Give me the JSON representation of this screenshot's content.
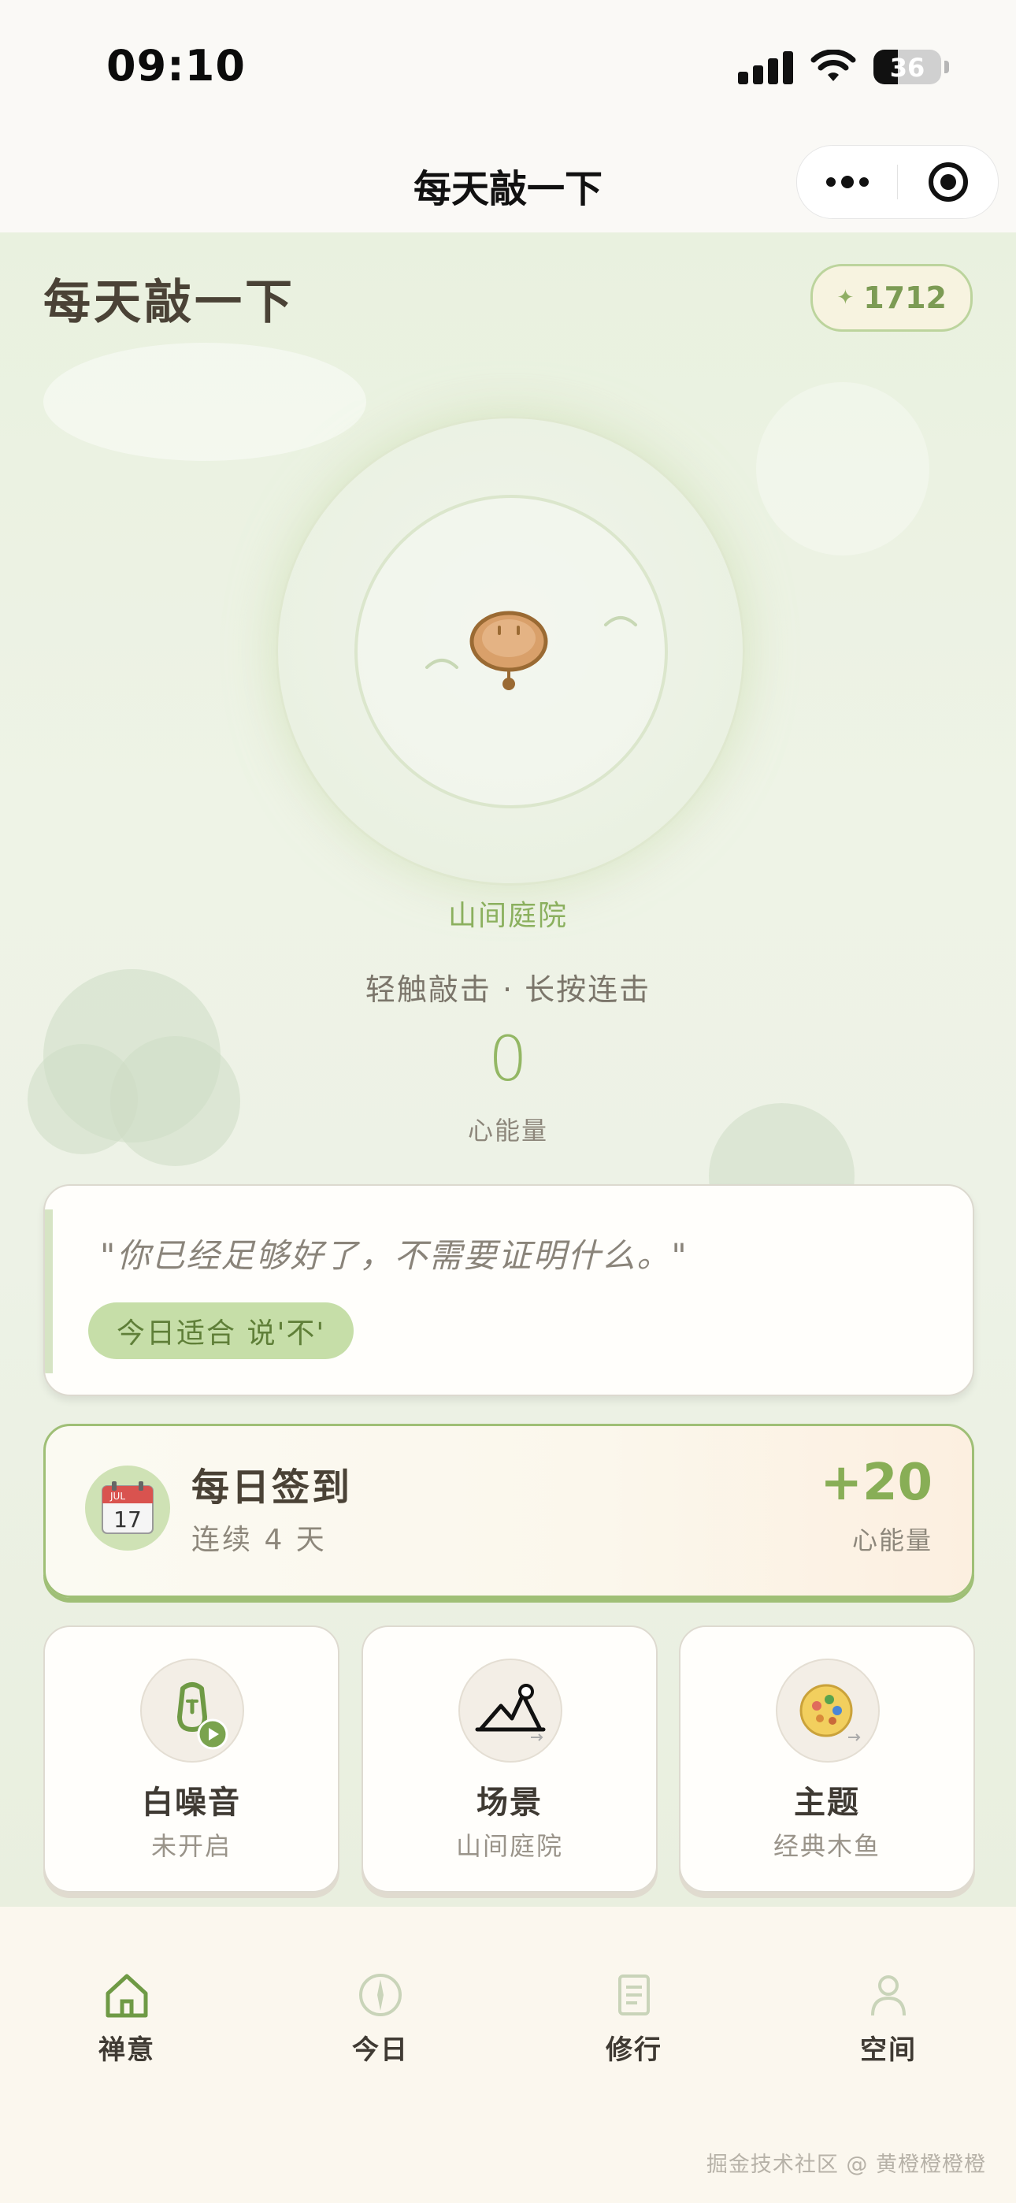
{
  "status_bar": {
    "time": "09:10",
    "battery": "36",
    "battery_percent": 36
  },
  "nav": {
    "title": "每天敲一下",
    "more_icon": "more-dots-icon",
    "close_icon": "target-circle-icon"
  },
  "header": {
    "app_title": "每天敲一下",
    "energy_total": "1712",
    "energy_icon": "sparkle-icon"
  },
  "tap_area": {
    "scene_name": "山间庭院",
    "hint": "轻触敲击 · 长按连击",
    "count": "0",
    "count_label": "心能量",
    "object_icon": "wooden-fish-icon"
  },
  "quote_card": {
    "quote": "\"你已经足够好了，不需要证明什么。\"",
    "tag": "今日适合 说'不'"
  },
  "checkin": {
    "title": "每日签到",
    "streak": "连续 4 天",
    "reward": "+20",
    "reward_unit": "心能量",
    "calendar_month": "JUL",
    "calendar_day": "17"
  },
  "tiles": [
    {
      "title": "白噪音",
      "subtitle": "未开启",
      "icon": "white-noise-icon"
    },
    {
      "title": "场景",
      "subtitle": "山间庭院",
      "icon": "mountain-icon"
    },
    {
      "title": "主题",
      "subtitle": "经典木鱼",
      "icon": "palette-icon"
    }
  ],
  "tabs": [
    {
      "label": "禅意",
      "icon": "home-icon",
      "active": true
    },
    {
      "label": "今日",
      "icon": "compass-icon",
      "active": false
    },
    {
      "label": "修行",
      "icon": "document-icon",
      "active": false
    },
    {
      "label": "空间",
      "icon": "person-icon",
      "active": false
    }
  ],
  "watermark": "掘金技术社区 @ 黄橙橙橙橙",
  "colors": {
    "accent_green": "#8bb05e",
    "background": "#eef3e6",
    "card": "#fffefb"
  }
}
